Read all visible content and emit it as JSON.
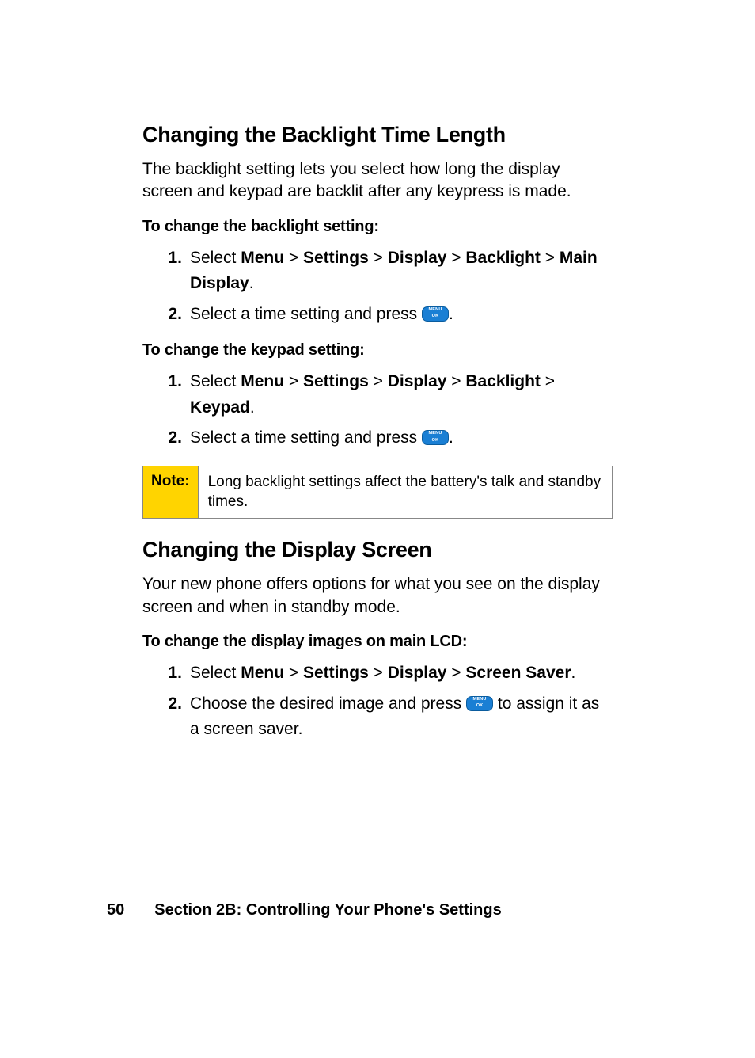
{
  "heading1": "Changing the Backlight Time Length",
  "intro1": "The backlight setting lets you select how long the display screen and keypad are backlit after any keypress is made.",
  "sub1": "To change the backlight setting:",
  "steps1": {
    "n1": "1.",
    "s1_pre": "Select ",
    "path1": {
      "a": "Menu",
      "b": "Settings",
      "c": "Display",
      "d": "Backlight",
      "e": "Main Display"
    },
    "n2": "2.",
    "s2_pre": "Select a time setting and press "
  },
  "sub2": "To change the keypad setting:",
  "steps2": {
    "n1": "1.",
    "s1_pre": "Select ",
    "path2": {
      "a": "Menu",
      "b": "Settings",
      "c": "Display",
      "d": "Backlight",
      "e": "Keypad"
    },
    "n2": "2.",
    "s2_pre": "Select a time setting and press "
  },
  "note": {
    "label": "Note:",
    "body": "Long backlight settings affect the battery's talk and standby times."
  },
  "heading2": "Changing the Display Screen",
  "intro2": "Your new phone offers options for what you see on the display screen and when in standby mode.",
  "sub3": "To change the display images on main LCD:",
  "steps3": {
    "n1": "1.",
    "s1_pre": "Select ",
    "path3": {
      "a": "Menu",
      "b": "Settings",
      "c": "Display",
      "d": "Screen Saver"
    },
    "n2": "2.",
    "s2_pre": "Choose the desired image and press ",
    "s2_post": " to assign it as a screen saver."
  },
  "gt": " > ",
  "period": ".",
  "footer": {
    "page": "50",
    "section": "Section 2B: Controlling Your Phone's Settings"
  },
  "icon_name": "menu-ok-key-icon"
}
